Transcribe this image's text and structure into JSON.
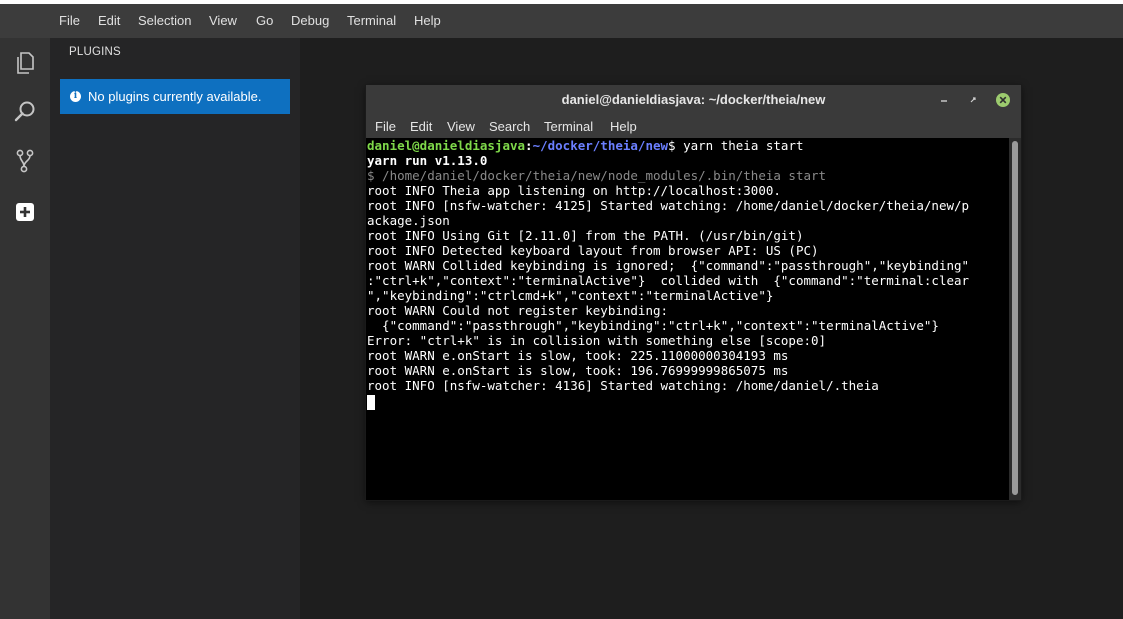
{
  "menubar": {
    "items": [
      "File",
      "Edit",
      "Selection",
      "View",
      "Go",
      "Debug",
      "Terminal",
      "Help"
    ]
  },
  "activitybar": {
    "icons": [
      "explorer-icon",
      "search-icon",
      "source-control-icon",
      "plugins-icon"
    ]
  },
  "sidepanel": {
    "title": "PLUGINS",
    "message": "No plugins currently available.",
    "message_bg": "#0e70c0"
  },
  "terminal": {
    "title": "daniel@danieldiasjava: ~/docker/theia/new",
    "menu": [
      "File",
      "Edit",
      "View",
      "Search",
      "Terminal",
      "Help"
    ],
    "prompt_user": "daniel@danieldiasjava",
    "prompt_sep": ":",
    "prompt_path": "~/docker/theia/new",
    "prompt_cmd": "$ yarn theia start",
    "lines": [
      "yarn run v1.13.0",
      "$ /home/daniel/docker/theia/new/node_modules/.bin/theia start",
      "root INFO Theia app listening on http://localhost:3000.",
      "root INFO [nsfw-watcher: 4125] Started watching: /home/daniel/docker/theia/new/p",
      "ackage.json",
      "root INFO Using Git [2.11.0] from the PATH. (/usr/bin/git)",
      "root INFO Detected keyboard layout from browser API: US (PC)",
      "root WARN Collided keybinding is ignored;  {\"command\":\"passthrough\",\"keybinding\"",
      ":\"ctrl+k\",\"context\":\"terminalActive\"}  collided with  {\"command\":\"terminal:clear",
      "\",\"keybinding\":\"ctrlcmd+k\",\"context\":\"terminalActive\"}",
      "root WARN Could not register keybinding:",
      "  {\"command\":\"passthrough\",\"keybinding\":\"ctrl+k\",\"context\":\"terminalActive\"}",
      "Error: \"ctrl+k\" is in collision with something else [scope:0]",
      "root WARN e.onStart is slow, took: 225.11000000304193 ms",
      "root WARN e.onStart is slow, took: 196.76999999865075 ms",
      "root INFO [nsfw-watcher: 4136] Started watching: /home/daniel/.theia"
    ],
    "colors": {
      "user": "#7fd94a",
      "path": "#6b7fff",
      "dim": "#8a8a8a"
    }
  }
}
